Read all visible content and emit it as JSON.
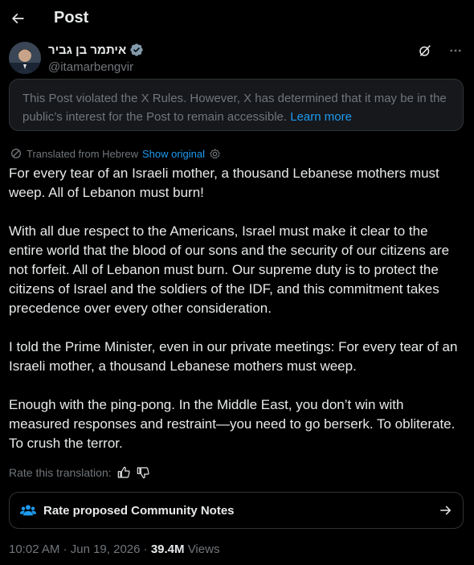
{
  "header": {
    "title": "Post"
  },
  "author": {
    "name": "איתמר בן גביר",
    "handle": "@itamarbengvir"
  },
  "notice": {
    "text": "This Post violated the X Rules. However, X has determined that it may be in the public’s interest for the Post to remain accessible.",
    "link": "Learn more"
  },
  "translation": {
    "label": "Translated from Hebrew",
    "show_original": "Show original"
  },
  "post": {
    "paragraphs": [
      "For every tear of an Israeli mother, a thousand Lebanese mothers must weep. All of Lebanon must burn!",
      "With all due respect to the Americans, Israel must make it clear to the entire world that the blood of our sons and the security of our citizens are not forfeit. All of Lebanon must burn. Our supreme duty is to protect the citizens of Israel and the soldiers of the IDF, and this commitment takes precedence over every other consideration.",
      "I told the Prime Minister, even in our private meetings: For every tear of an Israeli mother, a thousand Lebanese mothers must weep.",
      "Enough with the ping-pong. In the Middle East, you don’t win with measured responses and restraint—you need to go berserk. To obliterate. To crush the terror."
    ]
  },
  "rate": {
    "label": "Rate this translation:"
  },
  "community_notes": {
    "label": "Rate proposed Community Notes"
  },
  "meta": {
    "time": "10:02 AM",
    "date": "Jun 19, 2026",
    "views_count": "39.4M",
    "views_label": "Views"
  },
  "colors": {
    "accent": "#1d9bf0",
    "verified": "#829aab",
    "muted": "#71767b"
  }
}
